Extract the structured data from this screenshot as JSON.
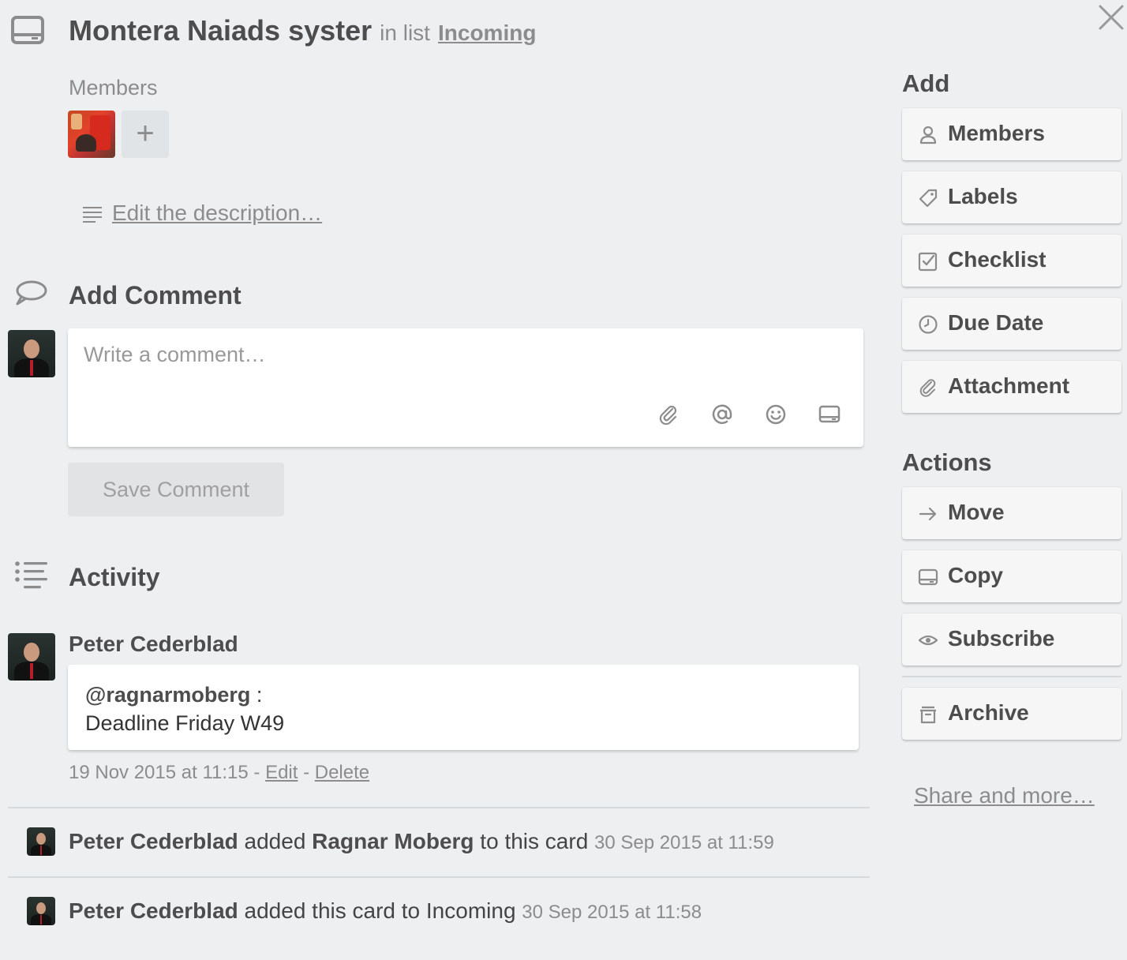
{
  "card": {
    "title": "Montera Naiads syster",
    "in_list_prefix": "in list",
    "list_name": "Incoming",
    "icons": {
      "card": "card-icon",
      "close": "close-icon"
    }
  },
  "members": {
    "label": "Members",
    "add_label": "+"
  },
  "description": {
    "link_text": "Edit the description…",
    "icon": "description-lines-icon"
  },
  "add_comment": {
    "title": "Add Comment",
    "placeholder": "Write a comment…",
    "save_label": "Save Comment",
    "tools": [
      "attachment-icon",
      "mention-icon",
      "emoji-icon",
      "card-link-icon"
    ]
  },
  "activity": {
    "title": "Activity",
    "comment": {
      "author": "Peter Cederblad",
      "mention": "@ragnarmoberg",
      "mention_suffix": " :",
      "text": "Deadline Friday W49",
      "timestamp": "19 Nov 2015 at 11:15",
      "sep1": " - ",
      "edit_label": "Edit",
      "sep2": " - ",
      "delete_label": "Delete"
    },
    "entries": [
      {
        "actor": "Peter Cederblad",
        "verb": " added ",
        "object": "Ragnar Moberg",
        "rest": " to this card ",
        "time": "30 Sep 2015 at 11:59"
      },
      {
        "actor": "Peter Cederblad",
        "verb": " added this card to Incoming ",
        "time": "30 Sep 2015 at 11:58"
      }
    ]
  },
  "sidebar": {
    "add_title": "Add",
    "add_buttons": [
      {
        "label": "Members",
        "icon": "person-icon"
      },
      {
        "label": "Labels",
        "icon": "tag-icon"
      },
      {
        "label": "Checklist",
        "icon": "checkbox-icon"
      },
      {
        "label": "Due Date",
        "icon": "clock-icon"
      },
      {
        "label": "Attachment",
        "icon": "paperclip-icon"
      }
    ],
    "actions_title": "Actions",
    "action_buttons": [
      {
        "label": "Move",
        "icon": "arrow-right-icon"
      },
      {
        "label": "Copy",
        "icon": "card-icon"
      },
      {
        "label": "Subscribe",
        "icon": "eye-icon"
      },
      {
        "label": "Archive",
        "icon": "archive-icon"
      }
    ],
    "share_label": "Share and more…"
  }
}
